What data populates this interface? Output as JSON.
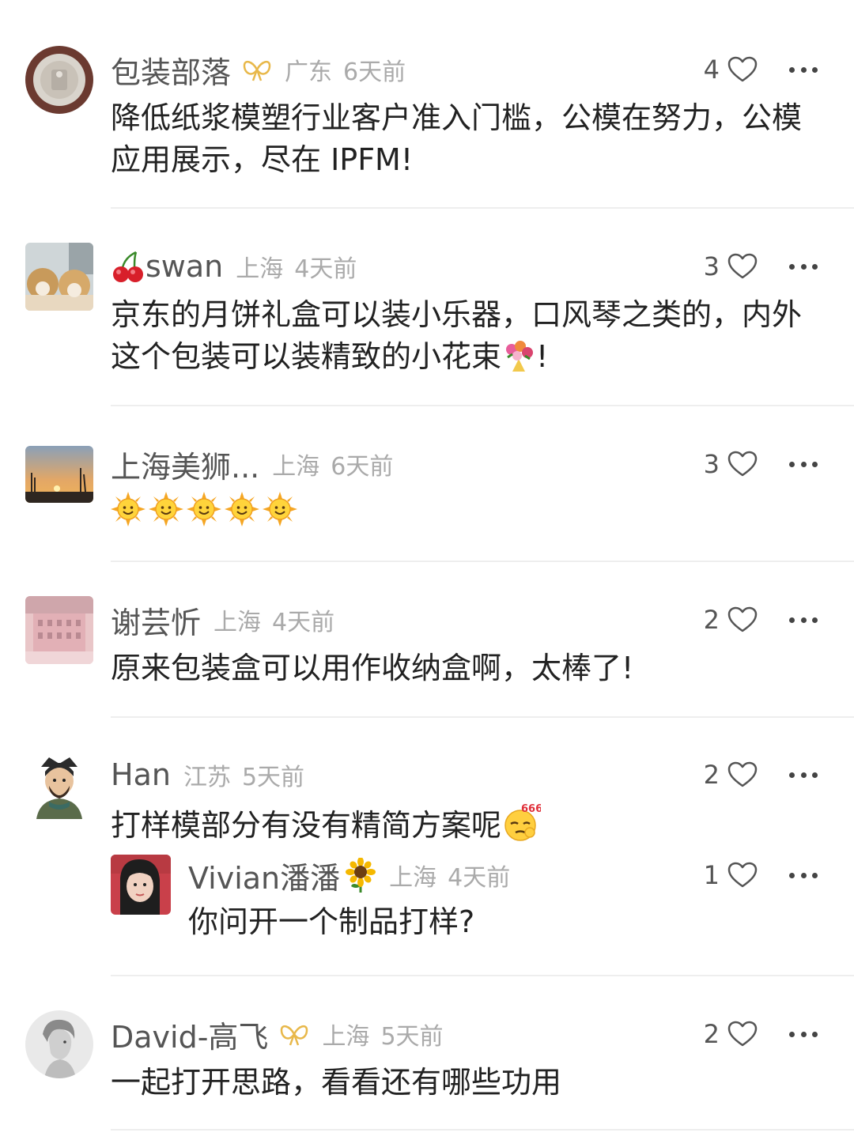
{
  "comments": [
    {
      "username": "包装部落",
      "location": "广东",
      "time": "6天前",
      "likes": "4",
      "text": "降低纸浆模塑行业客户准入门槛，公模在努力，公模应用展示，尽在 IPFM!",
      "verified": true
    },
    {
      "username": "swan",
      "location": "上海",
      "time": "4天前",
      "likes": "3",
      "text_main": "京东的月饼礼盒可以装小乐器，口风琴之类的，内外这个包装可以装精致的小花束",
      "text_end": "!"
    },
    {
      "username": "上海美狮...",
      "location": "上海",
      "time": "6天前",
      "likes": "3"
    },
    {
      "username": "谢芸忻",
      "location": "上海",
      "time": "4天前",
      "likes": "2",
      "text": "原来包装盒可以用作收纳盒啊，太棒了!"
    },
    {
      "username": "Han",
      "location": "江苏",
      "time": "5天前",
      "likes": "2",
      "text": "打样模部分有没有精简方案呢",
      "emoji_label": "666"
    },
    {
      "username": "David-高飞",
      "location": "上海",
      "time": "5天前",
      "likes": "2",
      "text": "一起打开思路，看看还有哪些功用",
      "verified": true
    }
  ],
  "reply": {
    "username": "Vivian潘潘",
    "location": "上海",
    "time": "4天前",
    "likes": "1",
    "text": "你问开一个制品打样?"
  },
  "colors": {
    "username": "#555555",
    "meta": "#aaaaaa",
    "text": "#222222",
    "badge": "#e8b84a",
    "divider": "#eeeeee"
  }
}
